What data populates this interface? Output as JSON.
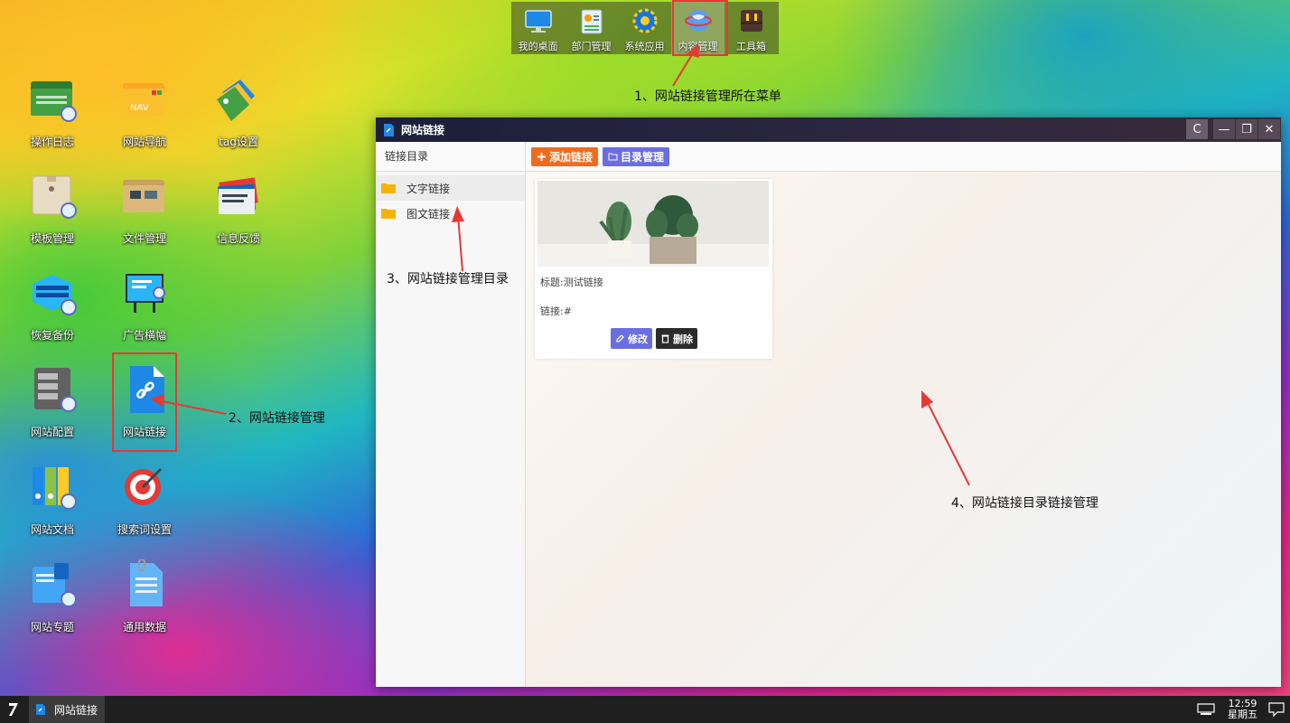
{
  "dock": {
    "items": [
      {
        "label": "我的桌面",
        "icon": "monitor-icon"
      },
      {
        "label": "部门管理",
        "icon": "id-card-icon"
      },
      {
        "label": "系统应用",
        "icon": "gear-icon"
      },
      {
        "label": "内容管理",
        "icon": "globe-icon",
        "active": true
      },
      {
        "label": "工具箱",
        "icon": "toolbox-icon"
      }
    ]
  },
  "desktop": {
    "icons": [
      {
        "label": "操作日志",
        "icon": "folder-log-icon"
      },
      {
        "label": "网站导航",
        "icon": "nav-folder-icon"
      },
      {
        "label": "tag设置",
        "icon": "tag-icon"
      },
      {
        "label": "模板管理",
        "icon": "template-folder-icon"
      },
      {
        "label": "文件管理",
        "icon": "file-folder-icon"
      },
      {
        "label": "信息反馈",
        "icon": "feedback-icon"
      },
      {
        "label": "恢复备份",
        "icon": "backup-icon"
      },
      {
        "label": "广告横幅",
        "icon": "banner-icon"
      },
      {
        "label": "网站配置",
        "icon": "server-config-icon"
      },
      {
        "label": "网站链接",
        "icon": "link-file-icon"
      },
      {
        "label": "网站文档",
        "icon": "binders-icon"
      },
      {
        "label": "搜索词设置",
        "icon": "target-icon"
      },
      {
        "label": "网站专题",
        "icon": "topic-doc-icon"
      },
      {
        "label": "通用数据",
        "icon": "data-doc-icon"
      }
    ]
  },
  "annotations": {
    "a1": "1、网站链接管理所在菜单",
    "a2": "2、网站链接管理",
    "a3": "3、网站链接管理目录",
    "a4": "4、网站链接目录链接管理"
  },
  "window": {
    "title": "网站链接",
    "refresh_icon": "C",
    "minimize_icon": "—",
    "maximize_icon": "❐",
    "close_icon": "✕",
    "sidebar": {
      "header": "链接目录",
      "items": [
        "文字链接",
        "图文链接"
      ]
    },
    "toolbar": {
      "add_label": "添加链接",
      "dir_label": "目录管理"
    },
    "card": {
      "title_line": "标题:测试链接",
      "link_line": "链接:#",
      "edit_label": "修改",
      "delete_label": "删除"
    }
  },
  "taskbar": {
    "task_label": "网站链接",
    "time": "12:59",
    "weekday": "星期五"
  },
  "colors": {
    "accent_orange": "#f26b1d",
    "accent_purple": "#6a6ee0",
    "annotation_red": "#e53935"
  }
}
